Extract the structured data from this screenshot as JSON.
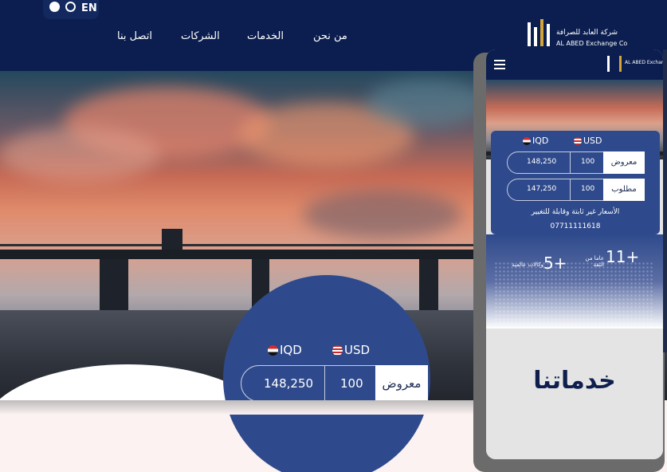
{
  "header": {
    "social": {
      "facebook_icon": "facebook-icon",
      "whatsapp_icon": "whatsapp-icon",
      "lang": "EN"
    },
    "nav": [
      "من نحن",
      "الخدمات",
      "الشركات",
      "اتصل بنا"
    ],
    "logo": {
      "arabic": "شركة العابد للصرافة",
      "english": "AL ABED Exchange Co"
    }
  },
  "hero": {
    "currencies": {
      "from": "USD",
      "to": "IQD"
    },
    "row": {
      "label": "معروض",
      "amount": "100",
      "result": "148,250"
    }
  },
  "mobile": {
    "currencies": {
      "from": "USD",
      "to": "IQD"
    },
    "rows": [
      {
        "label": "معروض",
        "amount": "100",
        "result": "148,250"
      },
      {
        "label": "مطلوب",
        "amount": "100",
        "result": "147,250"
      }
    ],
    "note": "الأسعار غير ثابتة وقابلة للتغيير",
    "phone": "07711111618",
    "stats": [
      {
        "number": "11+",
        "label": "عاما من الثقة"
      },
      {
        "number": "5+",
        "label": "وكالات عالمية"
      }
    ],
    "services_title": "خدماتنا"
  },
  "colors": {
    "navy": "#0b1e4f",
    "card_blue": "#2f4a8c",
    "gold": "#d4a63a"
  }
}
